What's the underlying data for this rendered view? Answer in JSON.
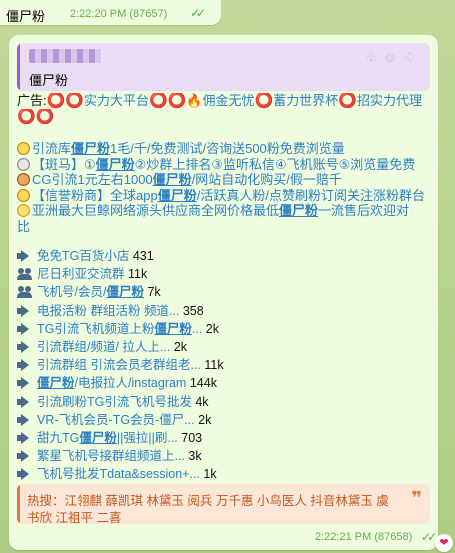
{
  "top_message": {
    "text": "僵尸粉",
    "meta": "2:22:20 PM (87657)",
    "ticks": "✓✓"
  },
  "main_message": {
    "reply": {
      "name": "僵尸粉",
      "deco": "♧☺♤"
    },
    "ad_line": {
      "prefix": "广告:",
      "rings1": "⭕⭕",
      "t1": "实力大平台",
      "rings2": "⭕⭕",
      "fire": "🔥",
      "t2": "佣金无忧",
      "ring3": "⭕",
      "t3": "蓄力世界杯",
      "ring4": "⭕",
      "t4": "招实力代理",
      "rings5": "⭕⭕"
    },
    "promo": [
      {
        "medal": "m1",
        "a": "引流库",
        "b": "僵尸粉",
        "c": "1毛/千/免费测试/咨询送500粉免费浏览量"
      },
      {
        "medal": "m2",
        "a": "【斑马】①",
        "b": "僵尸粉",
        "c": "②炒群上排名③监听私信④飞机账号⑤浏览量免费"
      },
      {
        "medal": "m3",
        "a": "CG引流1元左右1000",
        "b": "僵尸粉",
        "c": "/网站自动化购买/假一赔千"
      },
      {
        "medal": "m1",
        "a": "【信誉粉商】全球app",
        "b": "僵尸粉",
        "c": "/活跃真人粉/点赞刷粉订阅关注涨粉群台"
      },
      {
        "medal": "m4",
        "a": "亚洲最大巨鲸网络源头供应商全网价格最低",
        "b": "僵尸粉",
        "c": "一流售后欢迎对"
      }
    ],
    "promo_tail": "比",
    "channels": [
      {
        "icon": "speaker",
        "pre": "免免TG百货小店",
        "link": "",
        "post": "",
        "count": "431"
      },
      {
        "icon": "users",
        "pre": "尼日利亚交流群",
        "link": "",
        "post": "",
        "count": "11k"
      },
      {
        "icon": "users",
        "pre": "飞机号/会员/",
        "link": "僵尸粉",
        "post": "",
        "count": "7k"
      },
      {
        "icon": "speaker",
        "pre": "电报活粉 群组活粉 频道...",
        "link": "",
        "post": "",
        "count": "358"
      },
      {
        "icon": "speaker",
        "pre": "TG引流飞机频道上粉",
        "link": "僵尸粉",
        "post": "...",
        "count": "2k"
      },
      {
        "icon": "speaker",
        "pre": "引流群组/频道/ 拉人上...",
        "link": "",
        "post": "",
        "count": "2k"
      },
      {
        "icon": "speaker",
        "pre": "引流群组 引流会员老群组老...",
        "link": "",
        "post": "",
        "count": "11k"
      },
      {
        "icon": "speaker",
        "pre": "",
        "link": "僵尸粉",
        "post": "/电报拉人/instagram",
        "count": "144k"
      },
      {
        "icon": "speaker",
        "pre": "引流刷粉TG引流飞机号批发",
        "link": "",
        "post": "",
        "count": "4k"
      },
      {
        "icon": "speaker",
        "pre": "VR-飞机会员-TG会员-僵尸...",
        "link": "",
        "post": "",
        "count": "2k"
      },
      {
        "icon": "speaker",
        "pre": "甜九TG",
        "link": "僵尸粉",
        "post": "||强拉||刷...",
        "count": "703"
      },
      {
        "icon": "speaker",
        "pre": "繁星飞机号接群组频道上...",
        "link": "",
        "post": "",
        "count": "3k"
      },
      {
        "icon": "speaker",
        "pre": "飞机号批发Tdata&session+...",
        "link": "",
        "post": "",
        "count": "1k"
      }
    ],
    "quote": {
      "line1": "热搜：江翎麒 薛凯琪 林黛玉 阅兵 万千惠 小鸟医人 抖音林黛玉 虞",
      "line2": "书欣 江祖平 二喜",
      "mark": "❞"
    },
    "meta": "2:22:21 PM (87658)",
    "ticks": "✓✓"
  },
  "reaction": "❤",
  "colors": {
    "bubble": "#effdde",
    "link": "#2e7fc4",
    "accent_red": "#d9161b",
    "meta_green": "#5fae57"
  }
}
